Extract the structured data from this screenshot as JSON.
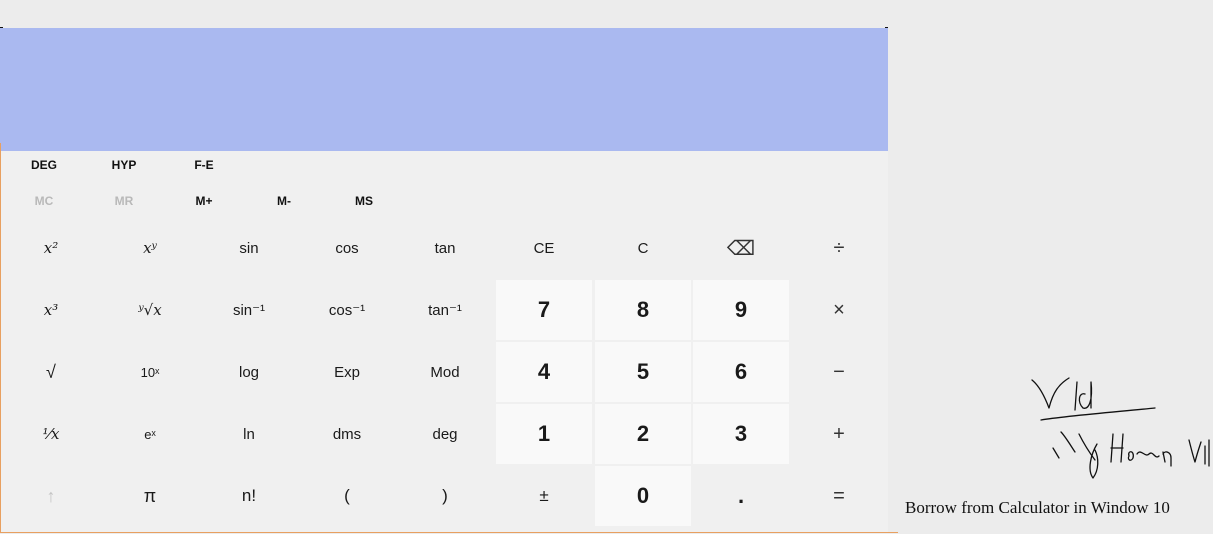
{
  "modes": [
    "DEG",
    "HYP",
    "F-E"
  ],
  "memory": [
    {
      "label": "MC",
      "enabled": false
    },
    {
      "label": "MR",
      "enabled": false
    },
    {
      "label": "M+",
      "enabled": true
    },
    {
      "label": "M-",
      "enabled": true
    },
    {
      "label": "MS",
      "enabled": true
    }
  ],
  "keys": {
    "square": "x²",
    "power": "xʸ",
    "sin": "sin",
    "cos": "cos",
    "tan": "tan",
    "ce": "CE",
    "c": "C",
    "backspace": "⌫",
    "divide": "÷",
    "cube": "x³",
    "yroot": "ʸ√x",
    "asin": "sin⁻¹",
    "acos": "cos⁻¹",
    "atan": "tan⁻¹",
    "seven": "7",
    "eight": "8",
    "nine": "9",
    "multiply": "×",
    "sqrt": "√",
    "ten_power": "10ˣ",
    "log": "log",
    "exp": "Exp",
    "mod": "Mod",
    "four": "4",
    "five": "5",
    "six": "6",
    "minus": "−",
    "reciprocal": "⅟x",
    "e_power": "eˣ",
    "ln": "ln",
    "dms": "dms",
    "deg": "deg",
    "one": "1",
    "two": "2",
    "three": "3",
    "plus": "+",
    "shift": "↑",
    "pi": "π",
    "factorial": "n!",
    "open_paren": "(",
    "close_paren": ")",
    "negate": "±",
    "zero": "0",
    "decimal": ".",
    "equals": "="
  },
  "note": "Borrow from Calculator in Window 10",
  "colors": {
    "display": "#aab9f0",
    "accent_border": "#e8a060"
  }
}
